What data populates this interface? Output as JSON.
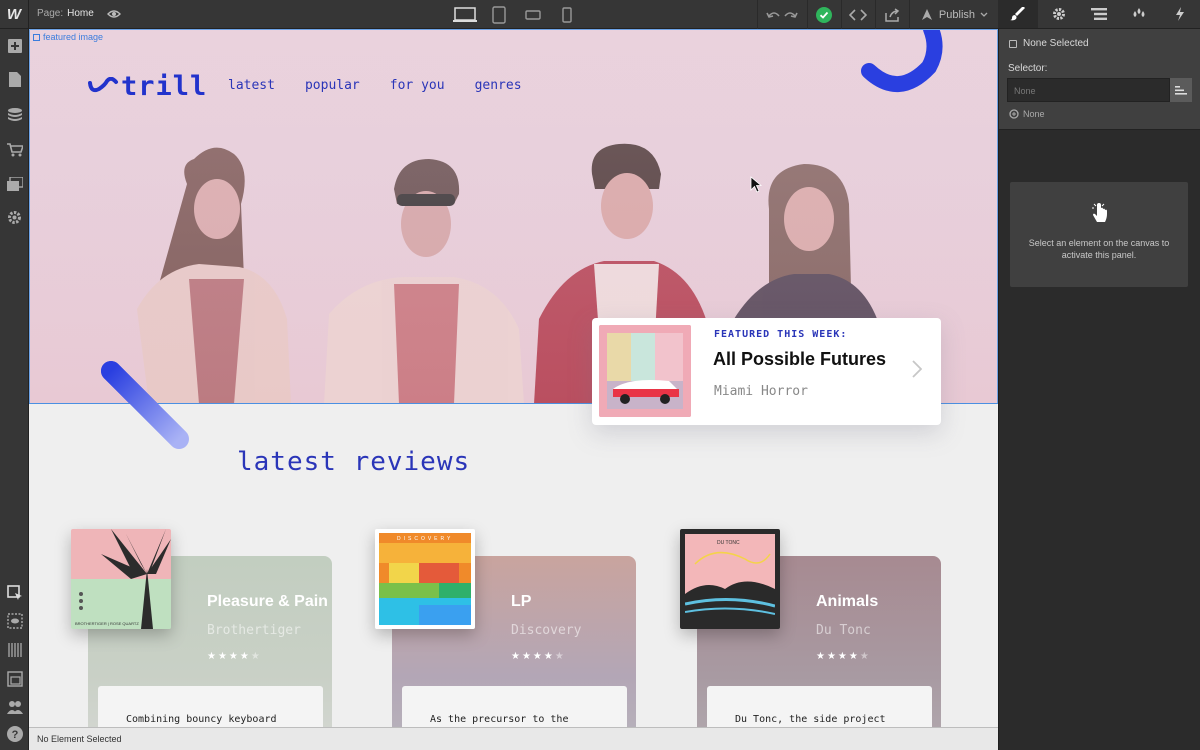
{
  "topbar": {
    "logo": "W",
    "page_prefix": "Page:",
    "page_name": "Home",
    "publish_label": "Publish"
  },
  "panel": {
    "none_selected": "None Selected",
    "selector_label": "Selector:",
    "selector_placeholder": "None",
    "none_state": "None",
    "hint": "Select an element on the canvas to activate this panel."
  },
  "status": "No Element Selected",
  "canvas": {
    "selected_tag": "featured image",
    "site": {
      "logo": "trill",
      "nav": [
        "latest",
        "popular",
        "for you",
        "genres"
      ],
      "featured": {
        "label": "FEATURED THIS WEEK:",
        "title": "All Possible Futures",
        "artist": "Miami Horror"
      },
      "latest_title": "latest reviews",
      "reviews": [
        {
          "title": "Pleasure & Pain",
          "artist": "Brothertiger",
          "rating": 4.5,
          "excerpt": "Combining bouncy keyboard",
          "art_caption": "BROTHERTIGER | ROSE QUARTZ",
          "card_color": "#c5cfc3"
        },
        {
          "title": "LP",
          "artist": "Discovery",
          "rating": 4.5,
          "excerpt": "As the precursor to the",
          "art_caption": "DISCOVERY",
          "card_color": "#c9a8a0"
        },
        {
          "title": "Animals",
          "artist": "Du Tonc",
          "rating": 4,
          "excerpt": "Du Tonc, the side project",
          "art_caption": "DU TONC",
          "card_color": "#a8868e"
        }
      ]
    }
  },
  "colors": {
    "brand_blue": "#2a35b8",
    "selection_blue": "#4a90e2",
    "publish_check": "#2fb55c"
  }
}
